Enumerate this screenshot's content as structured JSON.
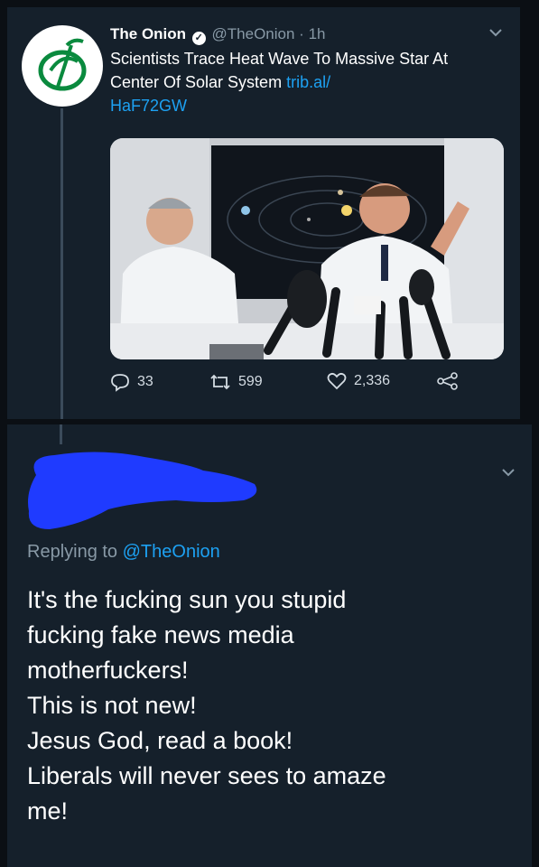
{
  "tweet": {
    "author_name": "The Onion",
    "handle": "@TheOnion",
    "time": "1h",
    "text": "Scientists Trace Heat Wave To Massive Star At Center Of Solar System",
    "link_line1": "trib.al/",
    "link_line2": "HaF72GW",
    "actions": {
      "replies": "33",
      "retweets": "599",
      "likes": "2,336"
    }
  },
  "reply": {
    "replying_prefix": "Replying to",
    "replying_handle": "@TheOnion",
    "lines": [
      "It's the fucking sun you stupid",
      "fucking fake news media",
      "motherfuckers!",
      "This is not new!",
      "Jesus God, read a book!",
      "Liberals will never sees to amaze",
      "me!"
    ]
  },
  "colors": {
    "background": "#15202b",
    "link": "#1da1f2",
    "muted": "#8899a6",
    "redaction": "#1f3bff"
  }
}
